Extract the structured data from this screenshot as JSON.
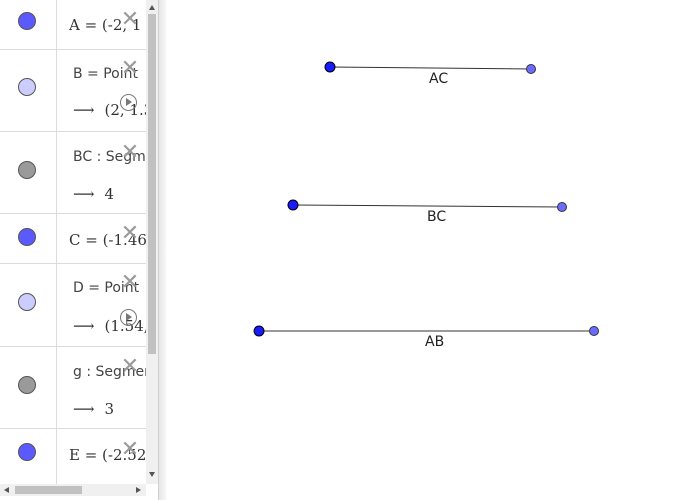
{
  "algebra": {
    "rows": [
      {
        "id": "A",
        "kind": "point",
        "color": "#5a5aff",
        "text": "A = (-2, 1"
      },
      {
        "id": "B",
        "kind": "dep-point",
        "color": "#ccccff",
        "definition": "B = Point",
        "output": "(2, 1.3"
      },
      {
        "id": "BC",
        "kind": "segment",
        "color": "#9a9a9a",
        "definition": "BC : Segm",
        "output": "4"
      },
      {
        "id": "C",
        "kind": "point",
        "color": "#5a5aff",
        "text": "C = (-1.46"
      },
      {
        "id": "D",
        "kind": "dep-point",
        "color": "#ccccff",
        "definition": "D = Point",
        "output": "(1.54,"
      },
      {
        "id": "g",
        "kind": "segment",
        "color": "#9a9a9a",
        "definition": "g : Segmen",
        "output": "3"
      },
      {
        "id": "E",
        "kind": "point",
        "color": "#5a5aff",
        "text": "E = (-2.52"
      }
    ],
    "arrow_glyph": "⟶",
    "close_glyph": "✕"
  },
  "graphics": {
    "colors": {
      "free_point": "#1a1aff",
      "dependent_point": "#6b6bff",
      "segment": "#333333"
    },
    "segments": [
      {
        "label": "AC"
      },
      {
        "label": "BC"
      },
      {
        "label": "AB"
      }
    ]
  }
}
